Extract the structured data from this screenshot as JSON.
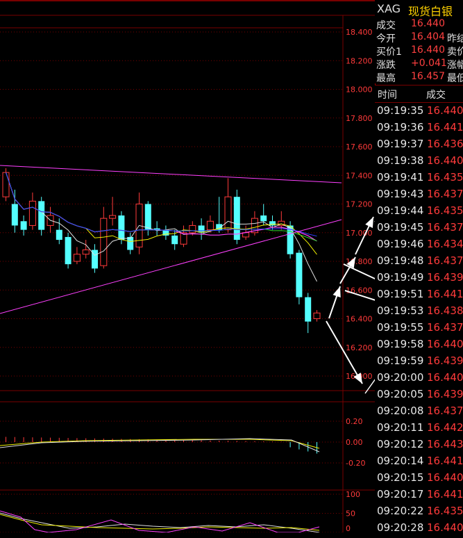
{
  "header": {
    "symbol": "XAG",
    "name": "现货白银"
  },
  "quote": [
    {
      "label": "成交",
      "value": "16.440",
      "label2": ""
    },
    {
      "label": "今开",
      "value": "16.404",
      "label2": "昨结"
    },
    {
      "label": "买价1",
      "value": "16.440",
      "label2": "卖价"
    },
    {
      "label": "涨跌",
      "value": "+0.041",
      "label2": "涨幅"
    },
    {
      "label": "最高",
      "value": "16.457",
      "label2": "最低"
    }
  ],
  "trades_header": {
    "time": "时间",
    "price": "成交"
  },
  "trades": [
    {
      "time": "09:19:35",
      "price": "16.440"
    },
    {
      "time": "09:19:36",
      "price": "16.441"
    },
    {
      "time": "09:19:37",
      "price": "16.436"
    },
    {
      "time": "09:19:38",
      "price": "16.440"
    },
    {
      "time": "09:19:41",
      "price": "16.435"
    },
    {
      "time": "09:19:43",
      "price": "16.437"
    },
    {
      "time": "09:19:44",
      "price": "16.435"
    },
    {
      "time": "09:19:45",
      "price": "16.437"
    },
    {
      "time": "09:19:46",
      "price": "16.434"
    },
    {
      "time": "09:19:48",
      "price": "16.437"
    },
    {
      "time": "09:19:49",
      "price": "16.439"
    },
    {
      "time": "09:19:51",
      "price": "16.441"
    },
    {
      "time": "09:19:53",
      "price": "16.438"
    },
    {
      "time": "09:19:55",
      "price": "16.437"
    },
    {
      "time": "09:19:58",
      "price": "16.440"
    },
    {
      "time": "09:19:59",
      "price": "16.439"
    },
    {
      "time": "09:20:00",
      "price": "16.440"
    },
    {
      "time": "09:20:05",
      "price": "16.439"
    },
    {
      "time": "09:20:08",
      "price": "16.437"
    },
    {
      "time": "09:20:11",
      "price": "16.442"
    },
    {
      "time": "09:20:12",
      "price": "16.443"
    },
    {
      "time": "09:20:14",
      "price": "16.441"
    },
    {
      "time": "09:20:15",
      "price": "16.440"
    },
    {
      "time": "09:20:17",
      "price": "16.441"
    },
    {
      "time": "09:20:22",
      "price": "16.435"
    },
    {
      "time": "09:20:28",
      "price": "16.440"
    }
  ],
  "main_axis_labels": [
    "18.400",
    "18.200",
    "18.000",
    "17.800",
    "17.600",
    "17.400",
    "17.200",
    "17.000",
    "16.800",
    "16.600",
    "16.400",
    "16.200",
    "16.000"
  ],
  "macd_axis_labels": [
    "0.20",
    "0.00",
    "-0.20"
  ],
  "kdj_axis_labels": [
    "100",
    "50",
    "0"
  ],
  "candles": [
    {
      "o": 17.25,
      "c": 17.42,
      "h": 17.45,
      "l": 17.22
    },
    {
      "o": 17.2,
      "c": 17.05,
      "h": 17.3,
      "l": 17.0
    },
    {
      "o": 17.08,
      "c": 17.02,
      "h": 17.12,
      "l": 16.98
    },
    {
      "o": 17.05,
      "c": 17.22,
      "h": 17.28,
      "l": 17.02
    },
    {
      "o": 17.22,
      "c": 17.02,
      "h": 17.25,
      "l": 16.98
    },
    {
      "o": 17.05,
      "c": 17.12,
      "h": 17.18,
      "l": 17.0
    },
    {
      "o": 17.02,
      "c": 16.95,
      "h": 17.1,
      "l": 16.92
    },
    {
      "o": 16.97,
      "c": 16.78,
      "h": 17.0,
      "l": 16.75
    },
    {
      "o": 16.8,
      "c": 16.85,
      "h": 16.9,
      "l": 16.78
    },
    {
      "o": 16.85,
      "c": 16.88,
      "h": 16.95,
      "l": 16.82
    },
    {
      "o": 16.88,
      "c": 16.75,
      "h": 16.92,
      "l": 16.72
    },
    {
      "o": 16.77,
      "c": 17.1,
      "h": 17.18,
      "l": 16.75
    },
    {
      "o": 17.1,
      "c": 17.12,
      "h": 17.25,
      "l": 17.05
    },
    {
      "o": 17.12,
      "c": 16.95,
      "h": 17.15,
      "l": 16.92
    },
    {
      "o": 16.97,
      "c": 16.88,
      "h": 17.0,
      "l": 16.85
    },
    {
      "o": 16.9,
      "c": 17.2,
      "h": 17.28,
      "l": 16.85
    },
    {
      "o": 17.2,
      "c": 17.02,
      "h": 17.22,
      "l": 16.98
    },
    {
      "o": 17.03,
      "c": 17.02,
      "h": 17.08,
      "l": 16.98
    },
    {
      "o": 17.02,
      "c": 16.98,
      "h": 17.05,
      "l": 16.95
    },
    {
      "o": 16.98,
      "c": 16.92,
      "h": 17.02,
      "l": 16.88
    },
    {
      "o": 16.92,
      "c": 17.0,
      "h": 17.05,
      "l": 16.9
    },
    {
      "o": 17.0,
      "c": 17.05,
      "h": 17.08,
      "l": 16.98
    },
    {
      "o": 17.05,
      "c": 17.0,
      "h": 17.1,
      "l": 16.95
    },
    {
      "o": 17.02,
      "c": 17.08,
      "h": 17.12,
      "l": 17.0
    },
    {
      "o": 17.06,
      "c": 17.02,
      "h": 17.25,
      "l": 17.0
    },
    {
      "o": 17.02,
      "c": 17.25,
      "h": 17.38,
      "l": 17.0
    },
    {
      "o": 17.25,
      "c": 16.95,
      "h": 17.3,
      "l": 16.92
    },
    {
      "o": 16.97,
      "c": 17.0,
      "h": 17.05,
      "l": 16.95
    },
    {
      "o": 17.0,
      "c": 17.1,
      "h": 17.15,
      "l": 16.98
    },
    {
      "o": 17.12,
      "c": 17.08,
      "h": 17.2,
      "l": 17.05
    },
    {
      "o": 17.08,
      "c": 17.05,
      "h": 17.12,
      "l": 17.02
    },
    {
      "o": 17.05,
      "c": 17.08,
      "h": 17.15,
      "l": 17.02
    },
    {
      "o": 17.05,
      "c": 16.85,
      "h": 17.08,
      "l": 16.82
    },
    {
      "o": 16.86,
      "c": 16.55,
      "h": 16.88,
      "l": 16.5
    },
    {
      "o": 16.55,
      "c": 16.38,
      "h": 16.58,
      "l": 16.3
    },
    {
      "o": 16.4,
      "c": 16.44,
      "h": 16.46,
      "l": 16.38
    }
  ],
  "colors": {
    "up": "#ff3a3a",
    "down": "#54ffff",
    "grid": "#7a0000",
    "axis_text": "#ff3a3a",
    "ma_white": "#e0e0e0",
    "ma_yellow": "#f0f000",
    "ma_magenta": "#ff40ff",
    "ma_green": "#30d030",
    "ma_blue": "#3040ff",
    "ma_gray": "#909090"
  }
}
